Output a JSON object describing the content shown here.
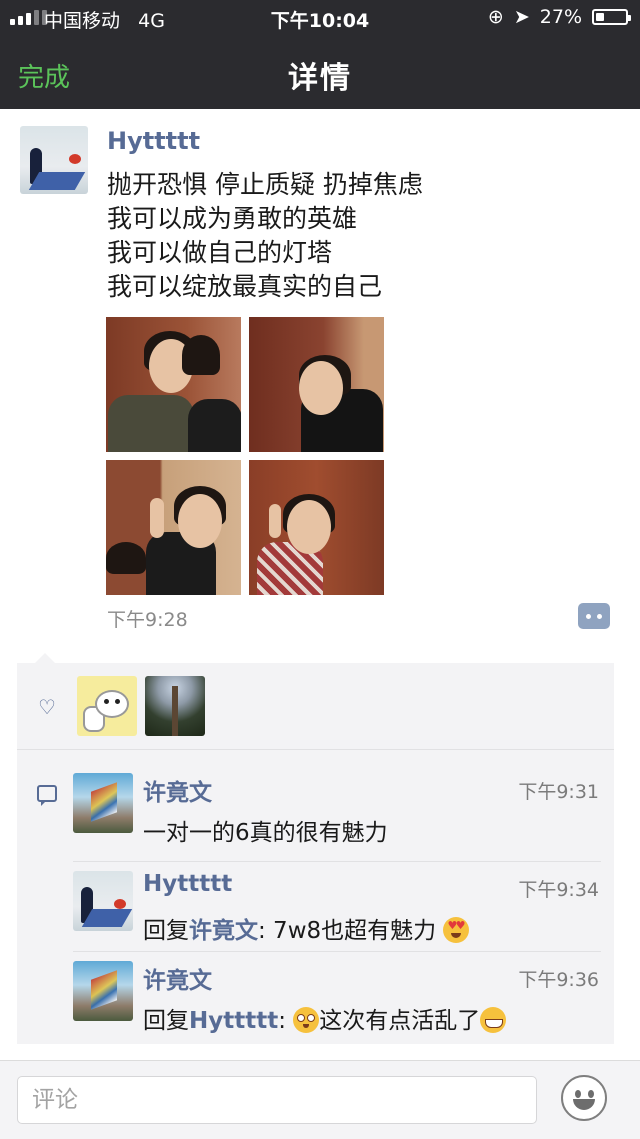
{
  "status_bar": {
    "carrier": "中国移动",
    "network": "4G",
    "time": "下午10:04",
    "battery": "27%",
    "battery_level": 0.27
  },
  "nav": {
    "done_label": "完成",
    "title": "详情"
  },
  "post": {
    "author": "Hyttttt",
    "lines": [
      "抛开恐惧 停止质疑 扔掉焦虑",
      "我可以成为勇敢的英雄",
      "我可以做自己的灯塔",
      "我可以绽放最真实的自己"
    ],
    "time": "下午9:28",
    "photos": [
      "photo-1",
      "photo-2",
      "photo-3",
      "photo-4"
    ]
  },
  "likes": {
    "icon": "heart-icon",
    "count": 2
  },
  "comments": [
    {
      "name": "许竟文",
      "time": "下午9:31",
      "text": "一对一的6真的很有魅力",
      "reply_prefix": "",
      "reply_to": "",
      "emoji": ""
    },
    {
      "name": "Hyttttt",
      "time": "下午9:34",
      "reply_prefix": "回复",
      "reply_to": "许竟文",
      "text": ": 7w8也超有魅力",
      "emoji": "heart-eyes"
    },
    {
      "name": "许竟文",
      "time": "下午9:36",
      "reply_prefix": "回复",
      "reply_to": "Hyttttt",
      "text_before": ": ",
      "text": "这次有点活乱了",
      "emoji_before": "flushed",
      "emoji": "grin"
    }
  ],
  "input": {
    "placeholder": "评论"
  },
  "colors": {
    "nav_bg": "#2b2b2f",
    "done_green": "#5bc35a",
    "link_blue": "#576b95"
  }
}
